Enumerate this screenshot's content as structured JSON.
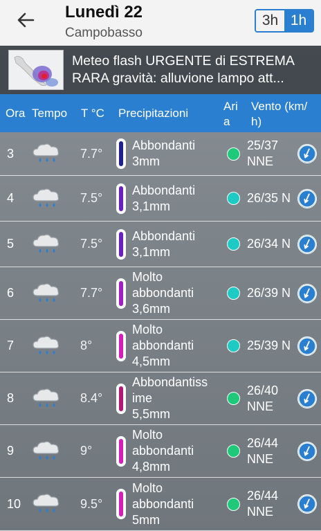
{
  "header": {
    "title": "Lunedì 22",
    "location": "Campobasso",
    "toggle_3h": "3h",
    "toggle_1h": "1h"
  },
  "alert": {
    "line1": "Meteo flash URGENTE di ESTREMA",
    "line2": "RARA gravità: alluvione lampo att..."
  },
  "columns": {
    "ora": "Ora",
    "tempo": "Tempo",
    "temp": "T °C",
    "prec": "Precipitazioni",
    "aria_1": "Ari",
    "aria_2": "a",
    "vento_1": "Vento (km/",
    "vento_2": "h)"
  },
  "colors": {
    "accent": "#2a7fd0",
    "dot_green": "#1ec97a",
    "dot_teal": "#1ecbc4"
  },
  "rows": [
    {
      "ora": "3",
      "temp": "7.7°",
      "prec": [
        "Abbondanti",
        "3mm"
      ],
      "therm_color": "#1f1f8f",
      "aria_color": "#1ec97a",
      "vento": [
        "25/37",
        "NNE"
      ]
    },
    {
      "ora": "4",
      "temp": "7.5°",
      "prec": [
        "Abbondanti",
        "3,1mm"
      ],
      "therm_color": "#6a1fbf",
      "aria_color": "#1ecbc4",
      "vento": [
        "26/35 N"
      ]
    },
    {
      "ora": "5",
      "temp": "7.5°",
      "prec": [
        "Abbondanti",
        "3,1mm"
      ],
      "therm_color": "#6a1fbf",
      "aria_color": "#1ecbc4",
      "vento": [
        "26/34 N"
      ]
    },
    {
      "ora": "6",
      "temp": "7.7°",
      "prec": [
        "Molto",
        "abbondanti",
        "3,6mm"
      ],
      "therm_color": "#a21fbf",
      "aria_color": "#1ecbc4",
      "vento": [
        "26/39 N"
      ]
    },
    {
      "ora": "7",
      "temp": "8°",
      "prec": [
        "Molto",
        "abbondanti",
        "4,5mm"
      ],
      "therm_color": "#d21fb8",
      "aria_color": "#1ecbc4",
      "vento": [
        "25/39 N"
      ]
    },
    {
      "ora": "8",
      "temp": "8.4°",
      "prec": [
        "Abbondantiss",
        "ime",
        "5,5mm"
      ],
      "therm_color": "#b0187a",
      "aria_color": "#1ec97a",
      "vento": [
        "26/40",
        "NNE"
      ]
    },
    {
      "ora": "9",
      "temp": "9°",
      "prec": [
        "Molto",
        "abbondanti",
        "4,8mm"
      ],
      "therm_color": "#d21fb8",
      "aria_color": "#1ec97a",
      "vento": [
        "26/44",
        "NNE"
      ]
    },
    {
      "ora": "10",
      "temp": "9.5°",
      "prec": [
        "Molto",
        "abbondanti",
        "5mm"
      ],
      "therm_color": "#d21fb8",
      "aria_color": "#1ec97a",
      "vento": [
        "26/44",
        "NNE"
      ]
    }
  ]
}
